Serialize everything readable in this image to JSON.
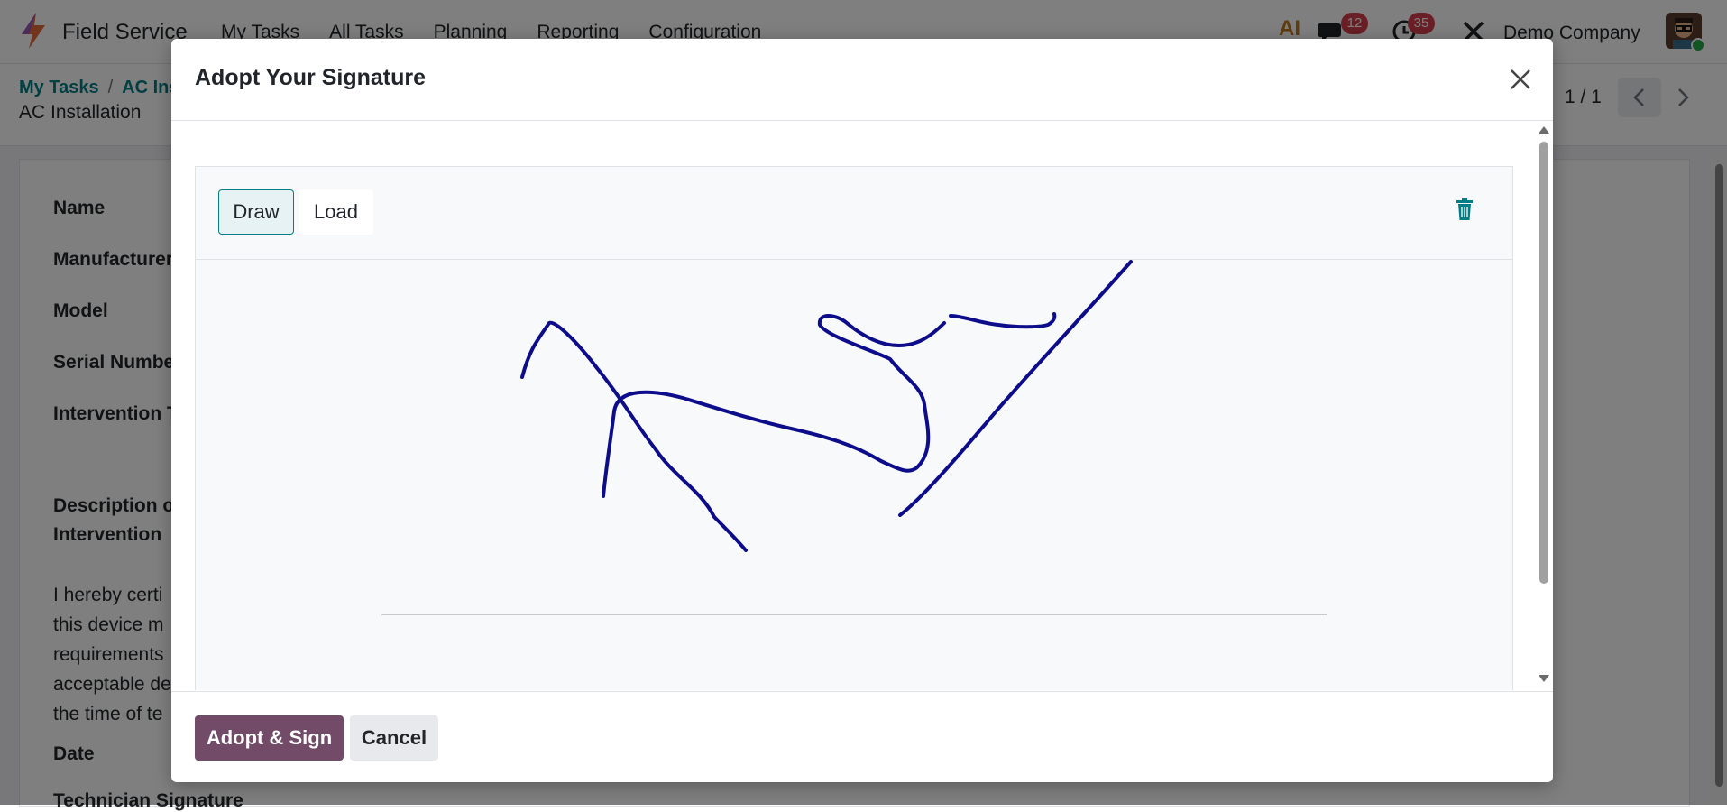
{
  "app": {
    "name": "Field Service",
    "menu": [
      "My Tasks",
      "All Tasks",
      "Planning",
      "Reporting",
      "Configuration"
    ],
    "ai_label": "AI",
    "messages_count": "12",
    "activities_count": "35",
    "company": "Demo Company"
  },
  "breadcrumb": {
    "items": [
      "My Tasks",
      "AC Ins"
    ],
    "current": "AC Installation"
  },
  "pager": {
    "value": "1 / 1"
  },
  "form": {
    "labels": [
      "Name",
      "Manufacturer",
      "Model",
      "Serial Number",
      "Intervention T",
      "Description of",
      "Intervention",
      "Date",
      "Technician Signature"
    ],
    "certify_lines": [
      "I hereby certi",
      "this device m",
      "requirements",
      "acceptable de",
      "the time of te"
    ]
  },
  "modal": {
    "title": "Adopt Your Signature",
    "modes": {
      "draw": "Draw",
      "load": "Load"
    },
    "active_mode": "Draw",
    "stroke_color": "#0d0d8c",
    "buttons": {
      "adopt": "Adopt & Sign",
      "cancel": "Cancel"
    }
  },
  "colors": {
    "primary": "#714b67",
    "accent": "#017e84",
    "badge": "#d23f4b"
  }
}
